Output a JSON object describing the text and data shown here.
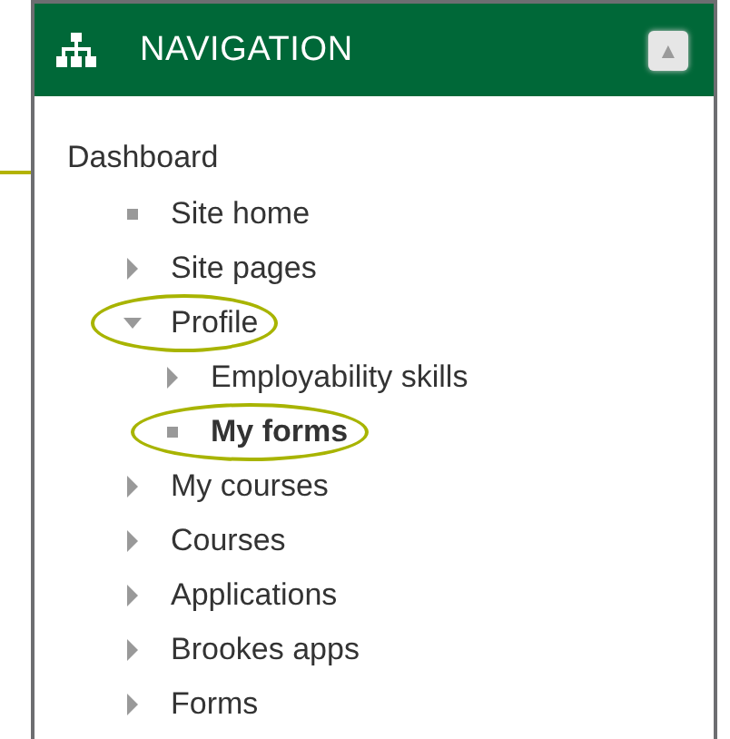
{
  "block": {
    "title": "NAVIGATION",
    "collapse_button": "▲"
  },
  "tree": [
    {
      "label": "Dashboard",
      "kind": "root",
      "current": false,
      "circled": false,
      "children": [
        {
          "label": "Site home",
          "kind": "leaf",
          "current": false,
          "circled": false
        },
        {
          "label": "Site pages",
          "kind": "branch",
          "expanded": false,
          "current": false,
          "circled": false
        },
        {
          "label": "Profile",
          "kind": "branch",
          "expanded": true,
          "current": false,
          "circled": true,
          "children": [
            {
              "label": "Employability skills",
              "kind": "branch",
              "expanded": false,
              "current": false,
              "circled": false
            },
            {
              "label": "My forms",
              "kind": "leaf",
              "current": true,
              "circled": true
            }
          ]
        },
        {
          "label": "My courses",
          "kind": "branch",
          "expanded": false,
          "current": false,
          "circled": false
        },
        {
          "label": "Courses",
          "kind": "branch",
          "expanded": false,
          "current": false,
          "circled": false
        },
        {
          "label": "Applications",
          "kind": "branch",
          "expanded": false,
          "current": false,
          "circled": false
        },
        {
          "label": "Brookes apps",
          "kind": "branch",
          "expanded": false,
          "current": false,
          "circled": false
        },
        {
          "label": "Forms",
          "kind": "branch",
          "expanded": false,
          "current": false,
          "circled": false
        }
      ]
    }
  ]
}
